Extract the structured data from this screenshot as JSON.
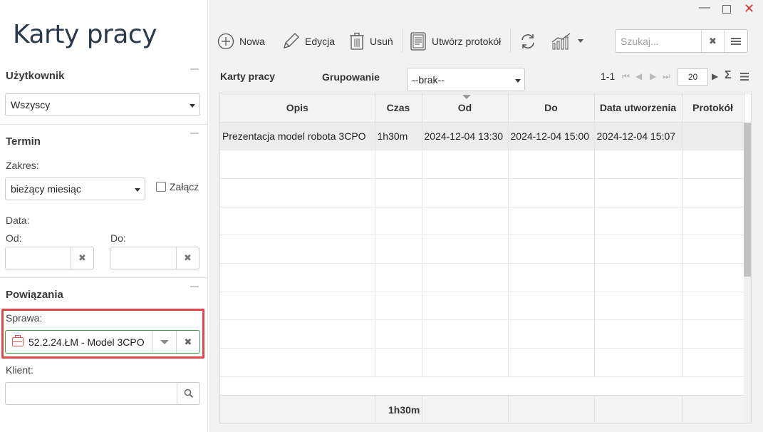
{
  "sidebar": {
    "title": "Karty pracy",
    "user_section": {
      "title": "Użytkownik",
      "select_value": "Wszyscy"
    },
    "term_section": {
      "title": "Termin",
      "range_label": "Zakres:",
      "range_value": "bieżący miesiąc",
      "attach_label": "Załącz",
      "date_label": "Data:",
      "from_label": "Od:",
      "to_label": "Do:"
    },
    "links_section": {
      "title": "Powiązania",
      "case_label": "Sprawa:",
      "case_value": "52.2.24.ŁM - Model 3CPO",
      "client_label": "Klient:"
    }
  },
  "toolbar": {
    "new_label": "Nowa",
    "edit_label": "Edycja",
    "delete_label": "Usuń",
    "protocol_label": "Utwórz protokół",
    "search_placeholder": "Szukaj..."
  },
  "grid_header": {
    "title": "Karty pracy",
    "grouping_label": "Grupowanie",
    "grouping_value": "--brak--",
    "range": "1-1",
    "page_size": "20"
  },
  "grid": {
    "columns": [
      "Opis",
      "Czas",
      "Od",
      "Do",
      "Data utworzenia",
      "Protokół"
    ],
    "rows": [
      [
        "Prezentacja model robota 3CPO",
        "1h30m",
        "2024-12-04 13:30",
        "2024-12-04 15:00",
        "2024-12-04 15:07",
        ""
      ]
    ],
    "footer_sum": "1h30m"
  },
  "colors": {
    "highlight": "#e0484c",
    "title": "#2a3a4c",
    "accent_green": "#3fa14a"
  }
}
